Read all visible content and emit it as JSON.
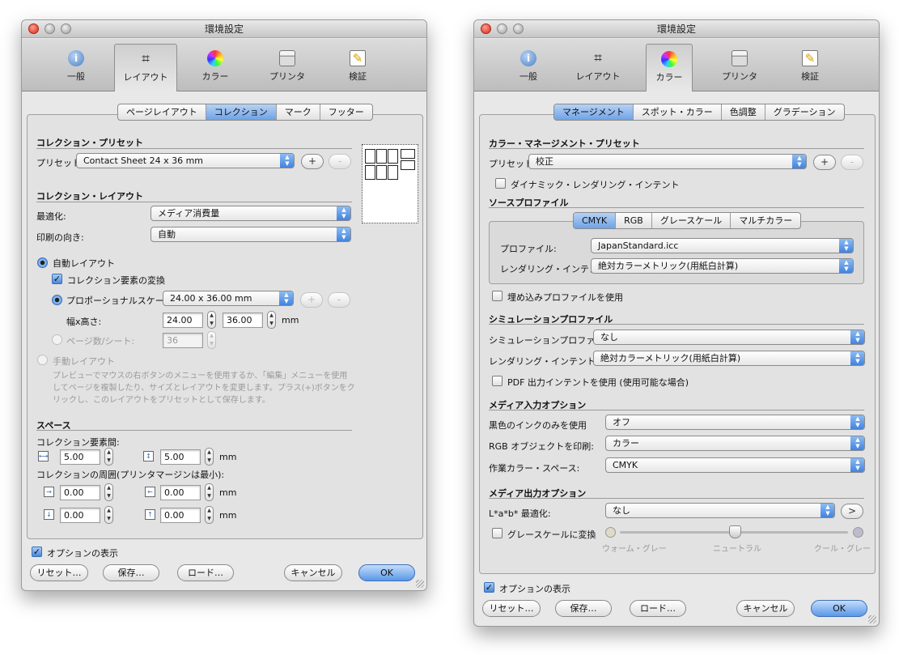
{
  "window_title": "環境設定",
  "toolbar": [
    "一般",
    "レイアウト",
    "カラー",
    "プリンタ",
    "検証"
  ],
  "left": {
    "subtabs": [
      "ページレイアウト",
      "コレクション",
      "マーク",
      "フッター"
    ],
    "collection_preset_header": "コレクション・プリセット",
    "preset_label": "プリセット:",
    "preset_value": "Contact Sheet 24 x 36 mm",
    "plus": "+",
    "minus": "-",
    "collection_layout_header": "コレクション・レイアウト",
    "optimize_label": "最適化:",
    "optimize_value": "メディア消費量",
    "orientation_label": "印刷の向き:",
    "orientation_value": "自動",
    "auto_layout": "自動レイアウト",
    "convert_elements": "コレクション要素の変換",
    "proportional_scale": "プロポーショナルスケール:",
    "scale_value": "24.00 x 36.00 mm",
    "wh_label": "幅x高さ:",
    "width_value": "24.00",
    "height_value": "36.00",
    "mm": "mm",
    "pages_per_sheet": "ページ数/シート:",
    "pages_value": "36",
    "manual_layout": "手動レイアウト",
    "manual_desc": [
      "プレビューでマウスの右ボタンのメニューを使用するか、「編集」メニューを使用",
      "してページを複製したり、サイズとレイアウトを変更します。プラス(+)ボタンをク",
      "リックし、このレイアウトをプリセットとして保存します。"
    ],
    "space_header": "スペース",
    "between_label": "コレクション要素間:",
    "between_h": "5.00",
    "between_v": "5.00",
    "margin_label": "コレクションの周囲(プリンタマージンは最小):",
    "margin_1": "0.00",
    "margin_2": "0.00",
    "margin_3": "0.00",
    "margin_4": "0.00",
    "show_options": "オプションの表示",
    "buttons": [
      "リセット…",
      "保存…",
      "ロード…",
      "キャンセル",
      "OK"
    ]
  },
  "right": {
    "subtabs": [
      "マネージメント",
      "スポット・カラー",
      "色調整",
      "グラデーション"
    ],
    "cm_preset_header": "カラー・マネージメント・プリセット",
    "preset_label": "プリセット:",
    "preset_value": "校正",
    "plus": "+",
    "minus": "-",
    "dynamic_intent": "ダイナミック・レンダリング・インテント",
    "source_header": "ソースプロファイル",
    "source_tabs": [
      "CMYK",
      "RGB",
      "グレースケール",
      "マルチカラー"
    ],
    "profile_label": "プロファイル:",
    "profile_value": "JapanStandard.icc",
    "intent_label": "レンダリング・インテント:",
    "intent_value": "絶対カラーメトリック(用紙白計算)",
    "embedded_profile": "埋め込みプロファイルを使用",
    "sim_header": "シミュレーションプロファイル",
    "sim_label": "シミュレーションプロファイル:",
    "sim_value": "なし",
    "sim_intent_label": "レンダリング・インテント:",
    "sim_intent_value": "絶対カラーメトリック(用紙白計算)",
    "pdf_intent": "PDF 出力インテントを使用 (使用可能な場合)",
    "media_in_header": "メディア入力オプション",
    "black_only_label": "黒色のインクのみを使用",
    "black_only_value": "オフ",
    "rgb_print_label": "RGB オブジェクトを印刷:",
    "rgb_print_value": "カラー",
    "work_space_label": "作業カラー・スペース:",
    "work_space_value": "CMYK",
    "media_out_header": "メディア出力オプション",
    "lab_label": "L*a*b* 最適化:",
    "lab_value": "なし",
    "next": ">",
    "gray_convert": "グレースケールに変換",
    "warm_gray": "ウォーム・グレー",
    "neutral": "ニュートラル",
    "cool_gray": "クール・グレー",
    "show_options": "オプションの表示",
    "buttons": [
      "リセット…",
      "保存…",
      "ロード…",
      "キャンセル",
      "OK"
    ]
  },
  "colors": {
    "accent": "#5b97e8",
    "window_bg": "#e8e8e8"
  }
}
